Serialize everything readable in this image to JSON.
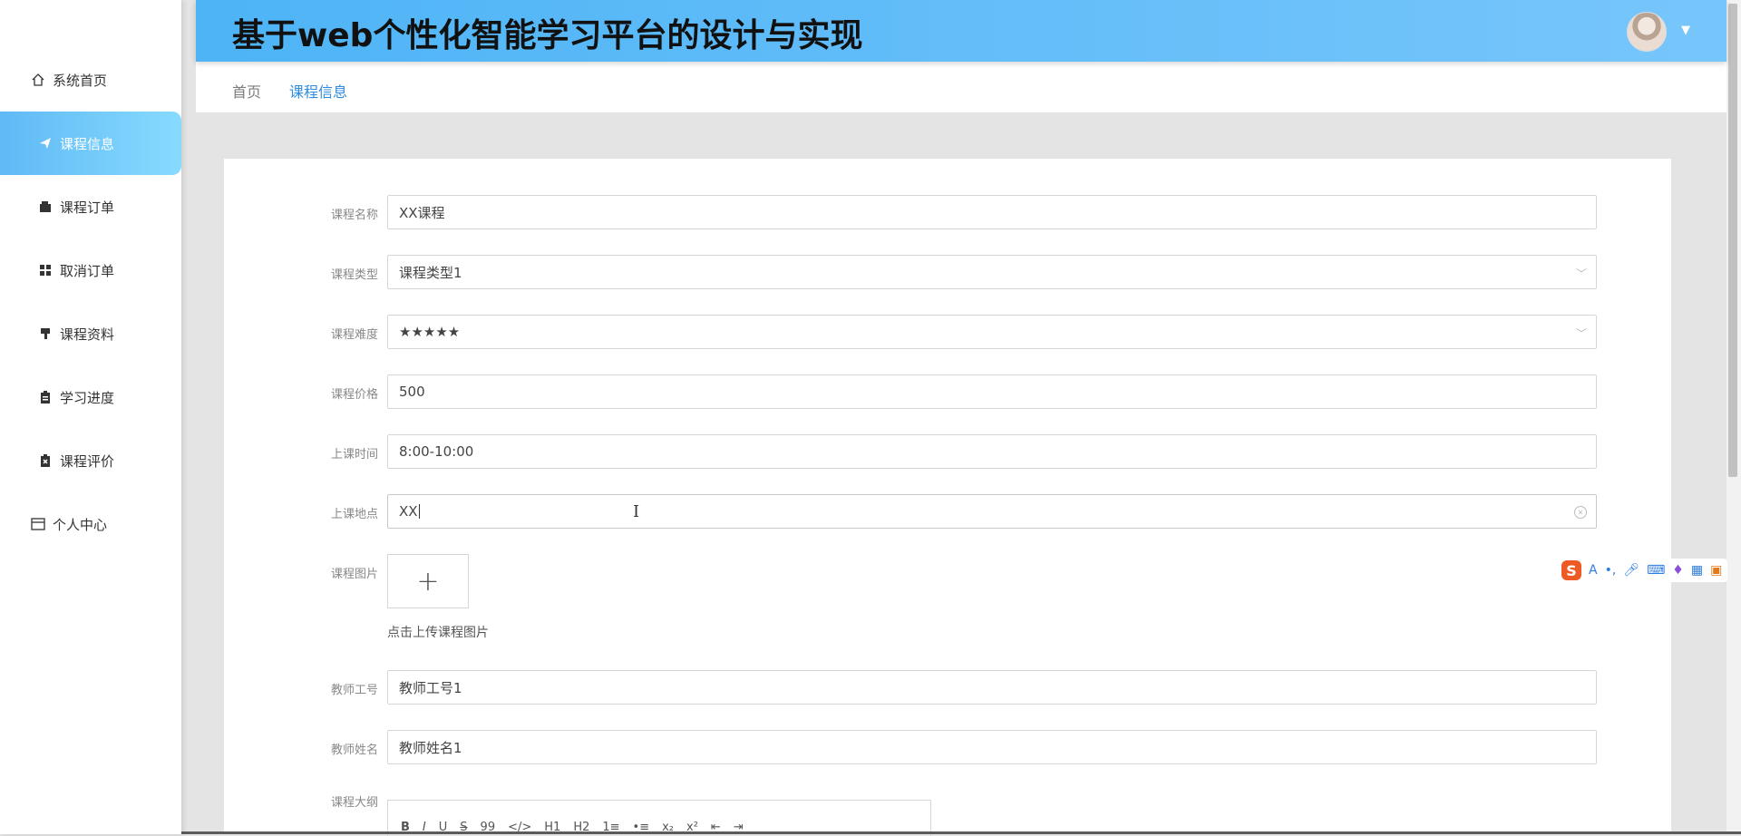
{
  "header": {
    "title": "基于web个性化智能学习平台的设计与实现"
  },
  "sidebar": {
    "items": [
      {
        "label": "系统首页",
        "icon": "home-icon"
      },
      {
        "label": "课程信息",
        "icon": "paper-plane-icon",
        "active": true
      },
      {
        "label": "课程订单",
        "icon": "wallet-icon"
      },
      {
        "label": "取消订单",
        "icon": "grid-icon"
      },
      {
        "label": "课程资料",
        "icon": "brush-icon"
      },
      {
        "label": "学习进度",
        "icon": "clipboard-icon"
      },
      {
        "label": "课程评价",
        "icon": "clipboard-x-icon"
      },
      {
        "label": "个人中心",
        "icon": "card-icon"
      }
    ]
  },
  "breadcrumb": {
    "home": "首页",
    "current": "课程信息"
  },
  "form": {
    "course_name": {
      "label": "课程名称",
      "value": "XX课程"
    },
    "course_type": {
      "label": "课程类型",
      "value": "课程类型1"
    },
    "difficulty": {
      "label": "课程难度",
      "value": "★★★★★"
    },
    "price": {
      "label": "课程价格",
      "value": "500"
    },
    "time": {
      "label": "上课时间",
      "value": "8:00-10:00"
    },
    "location": {
      "label": "上课地点",
      "value": "XX"
    },
    "image": {
      "label": "课程图片",
      "upload_symbol": "+",
      "hint": "点击上传课程图片"
    },
    "teacher_id": {
      "label": "教师工号",
      "value": "教师工号1"
    },
    "teacher_name": {
      "label": "教师姓名",
      "value": "教师姓名1"
    },
    "outline": {
      "label": "课程大纲"
    }
  },
  "editor_toolbar": [
    "B",
    "I",
    "U",
    "S",
    "99",
    "</>",
    "H1",
    "H2",
    "1≡",
    "•≡",
    "x₂",
    "x²",
    "⇤",
    "⇥"
  ],
  "ime": {
    "logo": "S",
    "letter": "A"
  }
}
